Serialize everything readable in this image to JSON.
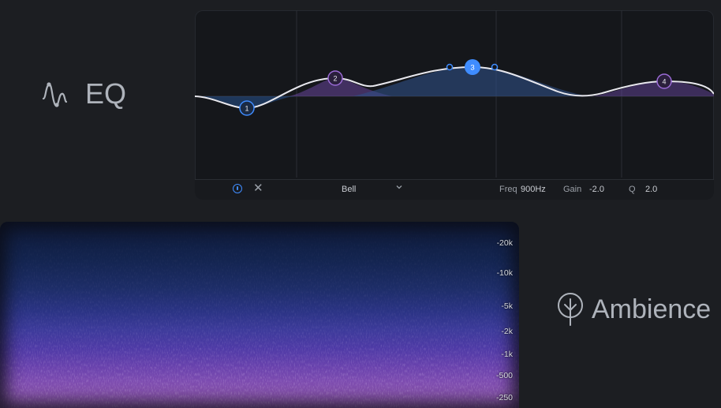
{
  "eq": {
    "label": "EQ",
    "bands": [
      {
        "number": "1",
        "selected": false
      },
      {
        "number": "2",
        "selected": false
      },
      {
        "number": "3",
        "selected": true
      },
      {
        "number": "4",
        "selected": false
      }
    ],
    "footer": {
      "filter_type": "Bell",
      "freq_label": "Freq",
      "freq_value": "900Hz",
      "gain_label": "Gain",
      "gain_value": "-2.0",
      "q_label": "Q",
      "q_value": "2.0"
    }
  },
  "spectrogram": {
    "ticks": [
      "-20k",
      "-10k",
      "-5k",
      "-2k",
      "-1k",
      "-500",
      "-250"
    ]
  },
  "ambience": {
    "label": "Ambience"
  },
  "colors": {
    "accent": "#3f8cff",
    "curve": "#e8e8ee",
    "band_purple": "#9b6bd6"
  }
}
